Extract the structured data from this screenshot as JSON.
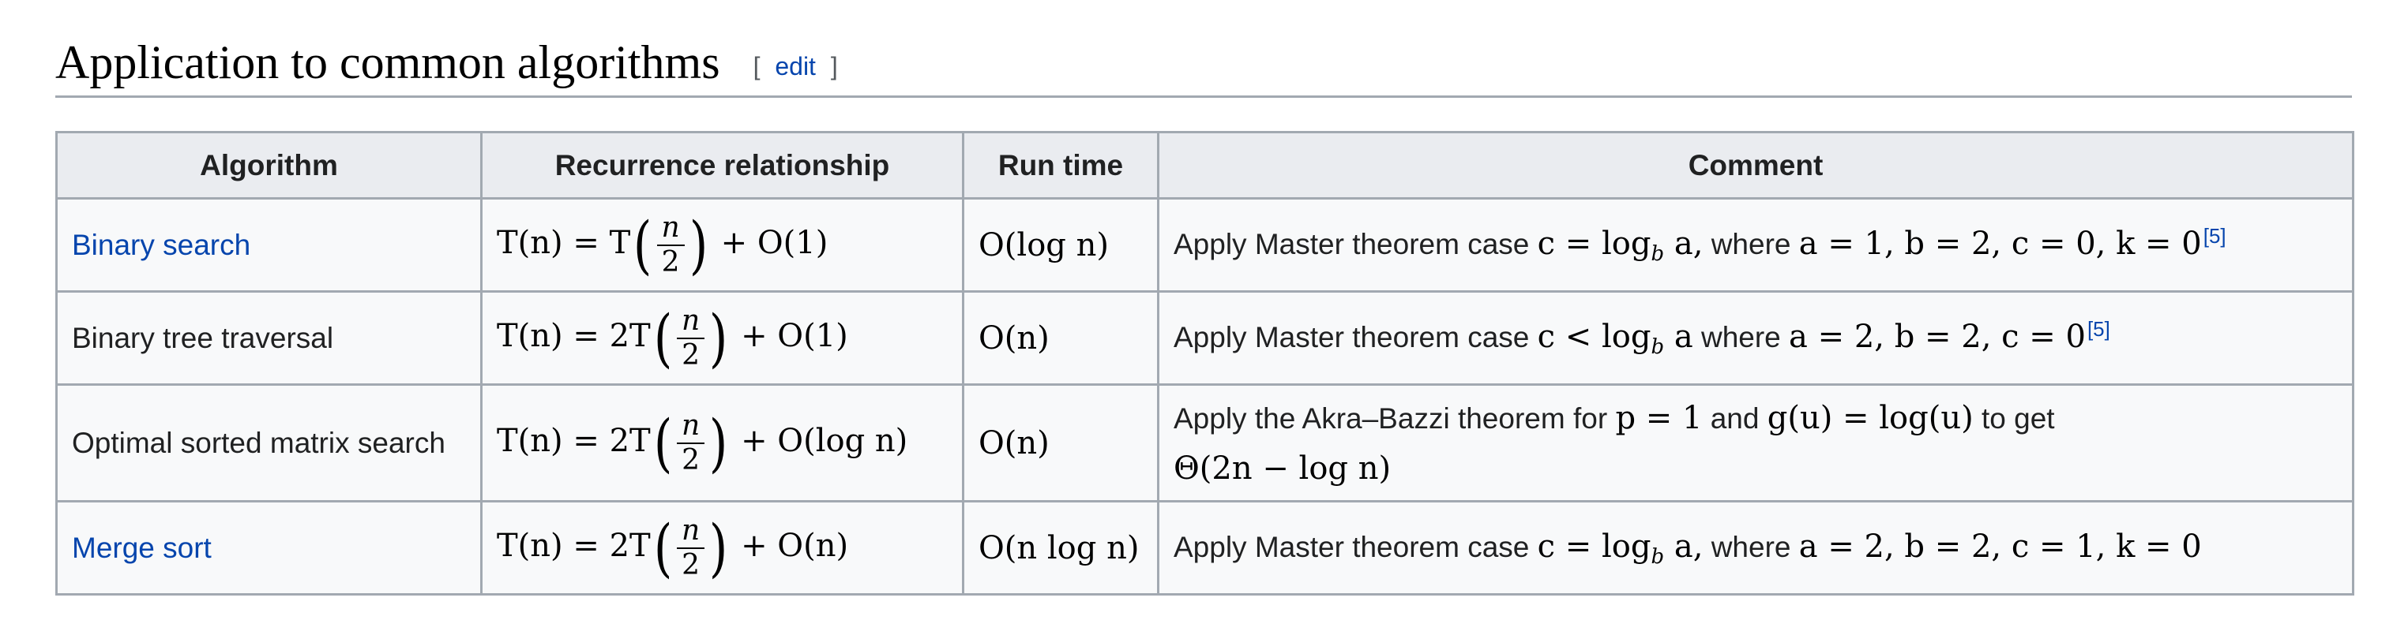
{
  "heading": {
    "title": "Application to common algorithms",
    "edit_open": "[",
    "edit_label": "edit",
    "edit_close": "]"
  },
  "table": {
    "headers": [
      "Algorithm",
      "Recurrence relationship",
      "Run time",
      "Comment"
    ],
    "rows": [
      {
        "algorithm": "Binary search",
        "algorithm_is_link": true,
        "recurrence": {
          "lhs": "T(n) = T",
          "num": "n",
          "den": "2",
          "rhs": "+ O(1)"
        },
        "run_time": "O(log n)",
        "comment": {
          "prefix": "Apply Master theorem case",
          "math1": "c = log",
          "math1_sub": "b",
          "math1_tail": " a,",
          "middle": "where",
          "math2": "a = 1, b = 2, c = 0, k = 0",
          "ref": "[5]"
        }
      },
      {
        "algorithm": "Binary tree traversal",
        "algorithm_is_link": false,
        "recurrence": {
          "lhs": "T(n) = 2T",
          "num": "n",
          "den": "2",
          "rhs": "+ O(1)"
        },
        "run_time": "O(n)",
        "comment": {
          "prefix": "Apply Master theorem case",
          "math1": "c < log",
          "math1_sub": "b",
          "math1_tail": " a",
          "middle": "where",
          "math2": "a = 2, b = 2, c = 0",
          "ref": "[5]"
        }
      },
      {
        "algorithm": "Optimal sorted matrix search",
        "algorithm_is_link": false,
        "recurrence": {
          "lhs": "T(n) = 2T",
          "num": "n",
          "den": "2",
          "rhs": "+ O(log n)"
        },
        "run_time": "O(n)",
        "comment": {
          "prefix": "Apply the",
          "link": "Akra–Bazzi theorem",
          "for_text": "for",
          "math_p": "p = 1",
          "and_text": "and",
          "math_g": "g(u) = log(u)",
          "to_get": "to get",
          "result": "Θ(2n − log n)"
        }
      },
      {
        "algorithm": "Merge sort",
        "algorithm_is_link": true,
        "recurrence": {
          "lhs": "T(n) = 2T",
          "num": "n",
          "den": "2",
          "rhs": "+ O(n)"
        },
        "run_time": "O(n log n)",
        "comment": {
          "prefix": "Apply Master theorem case",
          "math1": "c = log",
          "math1_sub": "b",
          "math1_tail": " a,",
          "middle": "where",
          "math2": "a = 2, b = 2, c = 1, k = 0"
        }
      }
    ]
  },
  "colors": {
    "link": "#0645ad",
    "border": "#a2a9b1",
    "header_bg": "#eaecf0",
    "cell_bg": "#f8f9fa",
    "text": "#202122"
  }
}
